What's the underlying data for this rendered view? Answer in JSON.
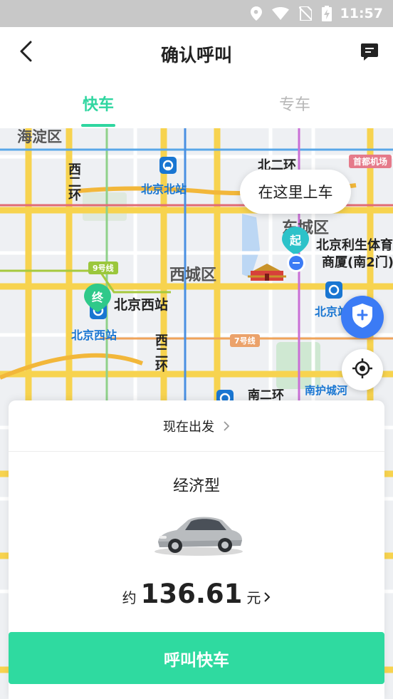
{
  "status_bar": {
    "time": "11:57",
    "icons": [
      "location-icon",
      "wifi-icon",
      "no-sim-icon",
      "battery-charging-icon"
    ]
  },
  "header": {
    "title": "确认呼叫",
    "back_icon": "back-chevron-icon",
    "message_icon": "message-icon"
  },
  "tabs": [
    {
      "label": "快车",
      "active": true
    },
    {
      "label": "专车",
      "active": false
    }
  ],
  "map": {
    "districts": [
      "海淀区",
      "西城区",
      "东城区"
    ],
    "roads": [
      "西二环",
      "西二环",
      "北二环",
      "南二环",
      "南护城河"
    ],
    "stations": [
      "北京北站",
      "北京西站",
      "北京站"
    ],
    "lines": [
      "9号线",
      "7号线"
    ],
    "pois": [
      "北京西站",
      "北京利生体育",
      "商厦(南2门)",
      "首都机场"
    ],
    "pickup_prompt": "在这里上车",
    "start_pin_label": "起",
    "end_pin_label": "终",
    "colors": {
      "accent": "#2fd6a0",
      "road": "#f7d34f",
      "pin_start": "#2cc2c9",
      "pin_end": "#2fc98a",
      "safety": "#3b7bf5"
    }
  },
  "card": {
    "depart_label": "现在出发",
    "car_type": "经济型",
    "price_prefix": "约",
    "price_value": "136.61",
    "price_unit": "元",
    "call_button": "呼叫快车"
  }
}
